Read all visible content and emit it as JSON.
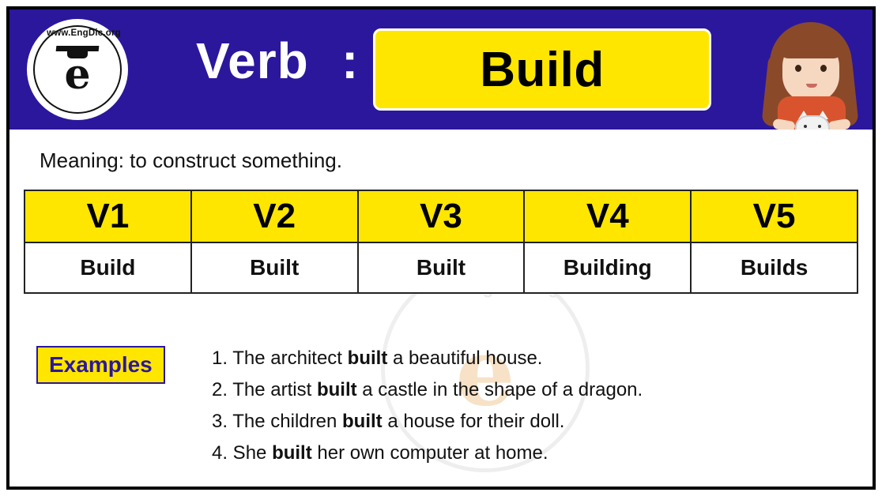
{
  "logo": {
    "top_text": "www.EngDic.org",
    "left_text": "www.",
    "right_text": "Dic.org",
    "mark": "e"
  },
  "header": {
    "verb_label": "Verb",
    "colon": ":",
    "verb_word": "Build",
    "avatar_alt": "girl-holding-cat-illustration"
  },
  "meaning": {
    "text": "Meaning: to construct something."
  },
  "table": {
    "headers": [
      "V1",
      "V2",
      "V3",
      "V4",
      "V5"
    ],
    "forms": [
      "Build",
      "Built",
      "Built",
      "Building",
      "Builds"
    ]
  },
  "examples": {
    "badge": "Examples",
    "items": [
      "1. The architect built a beautiful house.",
      "2. The artist built a castle in the shape of a dragon.",
      "3. The children built a house for their doll.",
      "4. She built her own computer at home."
    ]
  },
  "watermark": {
    "text": "www.EngDic.org",
    "mark": "e"
  },
  "colors": {
    "header_bg": "#2b179c",
    "accent_yellow": "#ffe600",
    "text_dark": "#111111",
    "border": "#222222"
  }
}
